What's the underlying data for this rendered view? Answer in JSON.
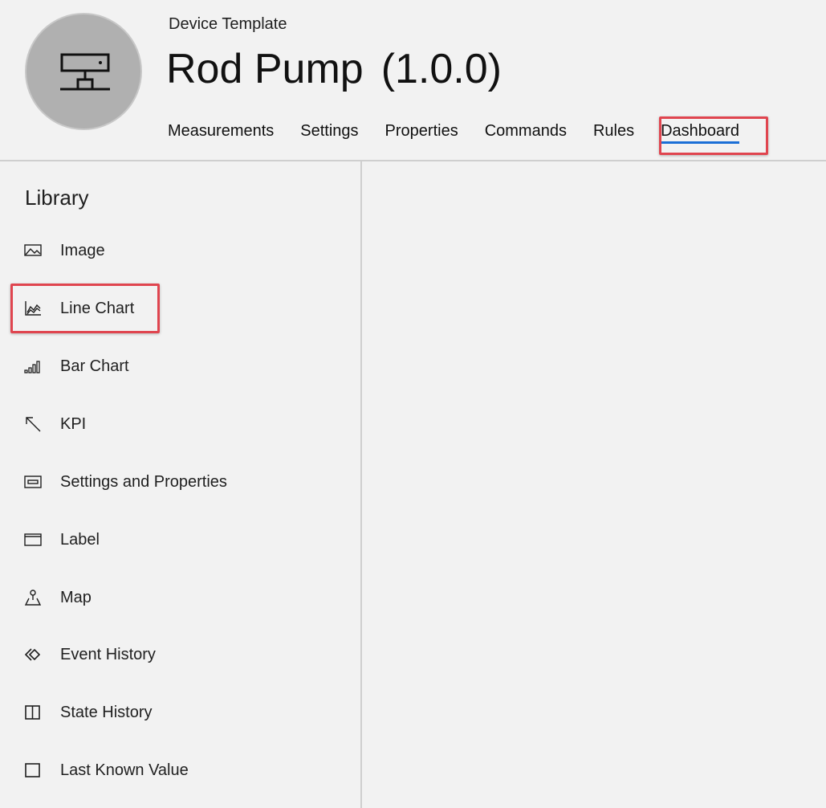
{
  "header": {
    "subtitle": "Device Template",
    "title": "Rod Pump",
    "version": "(1.0.0)",
    "avatar_icon": "network-device-icon"
  },
  "tabs": [
    {
      "label": "Measurements",
      "active": false
    },
    {
      "label": "Settings",
      "active": false
    },
    {
      "label": "Properties",
      "active": false
    },
    {
      "label": "Commands",
      "active": false
    },
    {
      "label": "Rules",
      "active": false
    },
    {
      "label": "Dashboard",
      "active": true
    }
  ],
  "library": {
    "title": "Library",
    "items": [
      {
        "label": "Image",
        "icon": "image-icon"
      },
      {
        "label": "Line Chart",
        "icon": "line-chart-icon",
        "highlighted": true
      },
      {
        "label": "Bar Chart",
        "icon": "bar-chart-icon"
      },
      {
        "label": "KPI",
        "icon": "arrow-up-left-icon"
      },
      {
        "label": "Settings and Properties",
        "icon": "settings-properties-icon"
      },
      {
        "label": "Label",
        "icon": "label-icon"
      },
      {
        "label": "Map",
        "icon": "map-icon"
      },
      {
        "label": "Event History",
        "icon": "event-history-icon"
      },
      {
        "label": "State History",
        "icon": "state-history-icon"
      },
      {
        "label": "Last Known Value",
        "icon": "last-known-value-icon"
      }
    ]
  },
  "colors": {
    "background": "#f2f2f2",
    "active_tab_underline": "#1b6fd6",
    "highlight_border": "#e0454f",
    "avatar": "#b0b0b0"
  }
}
